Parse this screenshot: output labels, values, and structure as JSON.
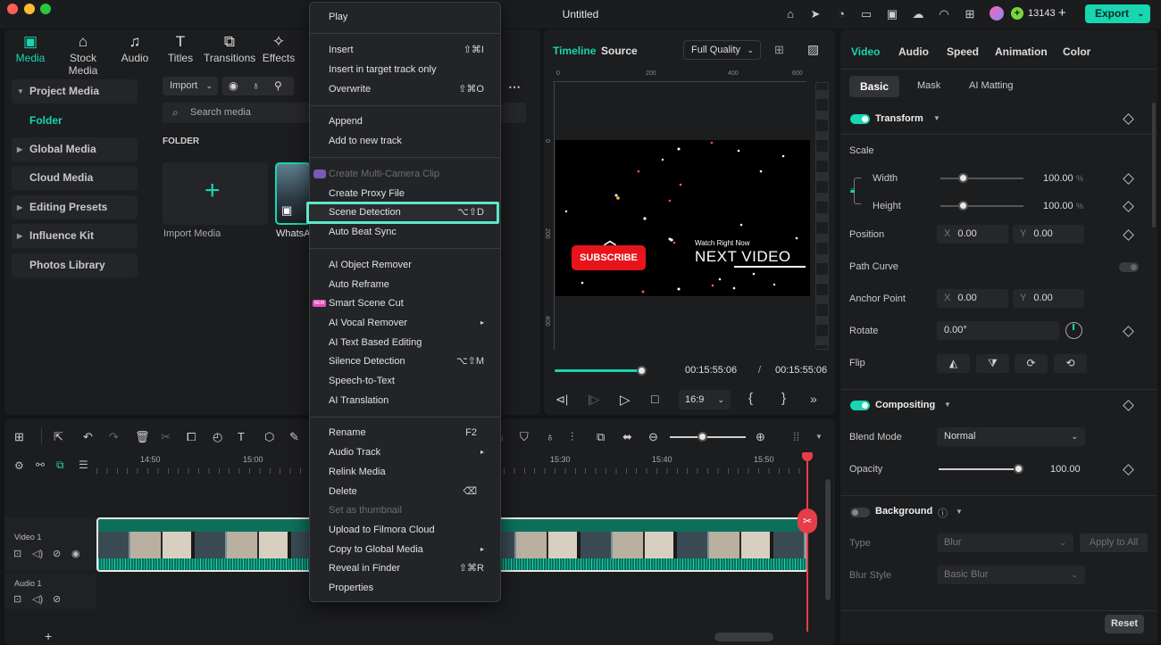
{
  "window": {
    "title": "Untitled",
    "credits": "13143",
    "export_label": "Export"
  },
  "colors": {
    "accent": "#17d6b0",
    "highlight": "#5de6c8",
    "playhead": "#e53d4a",
    "subscribe": "#e8141b"
  },
  "top_tabs": [
    {
      "label": "Media",
      "icon": "media-icon"
    },
    {
      "label": "Stock Media",
      "icon": "stock-media-icon"
    },
    {
      "label": "Audio",
      "icon": "audio-note-icon"
    },
    {
      "label": "Titles",
      "icon": "titles-icon"
    },
    {
      "label": "Transitions",
      "icon": "transitions-icon"
    },
    {
      "label": "Effects",
      "icon": "effects-icon"
    }
  ],
  "sidebar": {
    "items": [
      "Project Media",
      "Folder",
      "Global Media",
      "Cloud Media",
      "Editing Presets",
      "Influence Kit",
      "Photos Library"
    ]
  },
  "media": {
    "import_label": "Import",
    "search_placeholder": "Search media",
    "folder_label": "FOLDER",
    "import_media_label": "Import Media",
    "clip_name": "WhatsA"
  },
  "context_menu": {
    "items": [
      {
        "label": "Play",
        "shortcut": ""
      },
      {
        "label": "Insert",
        "shortcut": "⇧⌘I"
      },
      {
        "label": "Insert in target track only",
        "shortcut": ""
      },
      {
        "label": "Overwrite",
        "shortcut": "⇧⌘O"
      },
      {
        "label": "Append",
        "shortcut": ""
      },
      {
        "label": "Add to new track",
        "shortcut": ""
      },
      {
        "label": "Create Multi-Camera Clip",
        "shortcut": ""
      },
      {
        "label": "Create Proxy File",
        "shortcut": ""
      },
      {
        "label": "Scene Detection",
        "shortcut": "⌥⇧D"
      },
      {
        "label": "Auto Beat Sync",
        "shortcut": ""
      },
      {
        "label": "AI Object Remover",
        "shortcut": ""
      },
      {
        "label": "Auto Reframe",
        "shortcut": ""
      },
      {
        "label": "Smart Scene Cut",
        "shortcut": ""
      },
      {
        "label": "AI Vocal Remover",
        "shortcut": "▸"
      },
      {
        "label": "AI Text Based Editing",
        "shortcut": ""
      },
      {
        "label": "Silence Detection",
        "shortcut": "⌥⇧M"
      },
      {
        "label": "Speech-to-Text",
        "shortcut": ""
      },
      {
        "label": "AI Translation",
        "shortcut": ""
      },
      {
        "label": "Rename",
        "shortcut": "F2"
      },
      {
        "label": "Audio Track",
        "shortcut": "▸"
      },
      {
        "label": "Relink Media",
        "shortcut": ""
      },
      {
        "label": "Delete",
        "shortcut": "⌫"
      },
      {
        "label": "Set as thumbnail",
        "shortcut": ""
      },
      {
        "label": "Upload to Filmora Cloud",
        "shortcut": ""
      },
      {
        "label": "Copy to Global Media",
        "shortcut": "▸"
      },
      {
        "label": "Reveal in Finder",
        "shortcut": "⇧⌘R"
      },
      {
        "label": "Properties",
        "shortcut": ""
      }
    ],
    "new_badge": "NEW"
  },
  "player": {
    "tabs": [
      "Timeline",
      "Source"
    ],
    "quality": "Full Quality",
    "ruler": [
      "0",
      "200",
      "400",
      "600"
    ],
    "vruler": [
      "0",
      "200",
      "400"
    ],
    "current_time": "00:15:55:06",
    "separator": "/",
    "total_time": "00:15:55:06",
    "aspect": "16:9",
    "progress": 1.0,
    "subscribe_label": "SUBSCRIBE",
    "watch_label": "Watch Right Now",
    "next_label": "NEXT VIDEO"
  },
  "timeline": {
    "marks": [
      "14:50",
      "15:00",
      "15:30",
      "15:40",
      "15:50"
    ],
    "video_track": "Video 1",
    "audio_track": "Audio 1",
    "add_label": "+"
  },
  "inspector": {
    "tabs": [
      "Video",
      "Audio",
      "Speed",
      "Animation",
      "Color"
    ],
    "subtabs": [
      "Basic",
      "Mask",
      "AI Matting"
    ],
    "transform": "Transform",
    "scale": "Scale",
    "width": "Width",
    "width_value": "100.00",
    "height": "Height",
    "height_value": "100.00",
    "percent": "%",
    "position": "Position",
    "pos_x": "0.00",
    "pos_y": "0.00",
    "path_curve": "Path Curve",
    "anchor": "Anchor Point",
    "anchor_x": "0.00",
    "anchor_y": "0.00",
    "x_label": "X",
    "y_label": "Y",
    "rotate": "Rotate",
    "rotate_value": "0.00°",
    "flip": "Flip",
    "compositing": "Compositing",
    "blend_mode": "Blend Mode",
    "blend_value": "Normal",
    "opacity": "Opacity",
    "opacity_value": "100.00",
    "background": "Background",
    "type": "Type",
    "type_value": "Blur",
    "apply_all": "Apply to All",
    "blur_style": "Blur Style",
    "blur_value": "Basic Blur",
    "reset": "Reset"
  }
}
